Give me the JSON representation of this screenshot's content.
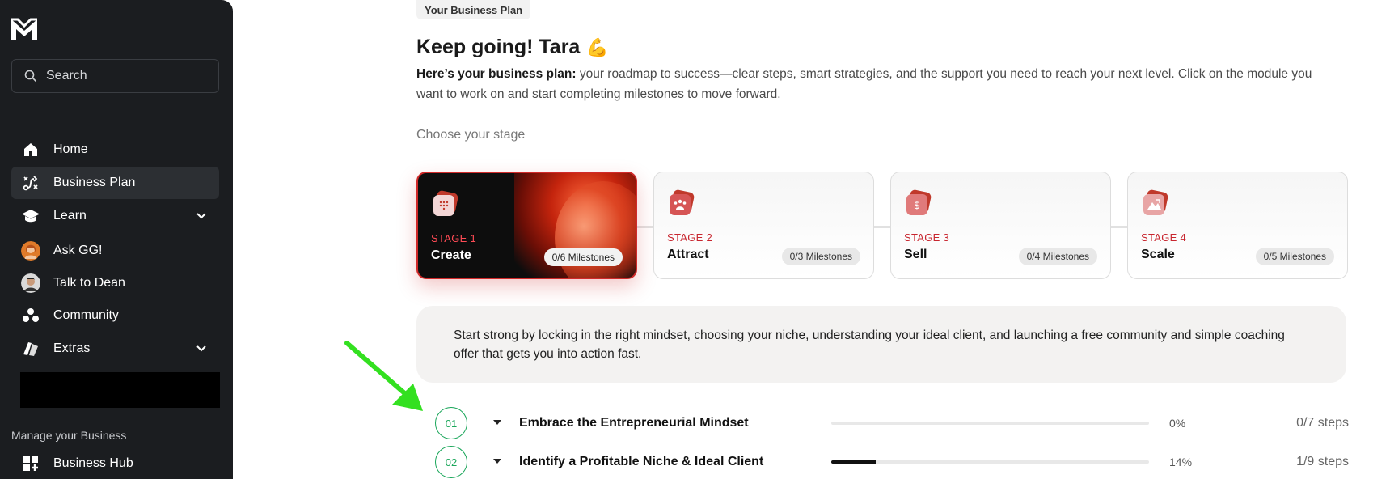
{
  "sidebar": {
    "search_placeholder": "Search",
    "items": [
      {
        "label": "Home",
        "icon": "home-icon"
      },
      {
        "label": "Business Plan",
        "icon": "route-icon"
      },
      {
        "label": "Learn",
        "icon": "graduation-cap-icon"
      },
      {
        "label": "Ask GG!",
        "icon": "avatar"
      },
      {
        "label": "Talk to Dean",
        "icon": "avatar"
      },
      {
        "label": "Community",
        "icon": "community-icon"
      },
      {
        "label": "Extras",
        "icon": "extras-icon"
      }
    ],
    "section_label": "Manage your Business",
    "hub_label": "Business Hub"
  },
  "header": {
    "tag": "Your Business Plan",
    "greeting": "Keep going! Tara",
    "emoji": "💪",
    "intro_bold": "Here’s your business plan:",
    "intro_rest": " your roadmap to success—clear steps, smart strategies, and the support you need to reach your next level. Click on the module you want to work on and start completing milestones to move forward.",
    "choose_label": "Choose your stage"
  },
  "stages": [
    {
      "label": "STAGE 1",
      "name": "Create",
      "milestones": "0/6 Milestones"
    },
    {
      "label": "STAGE 2",
      "name": "Attract",
      "milestones": "0/3 Milestones"
    },
    {
      "label": "STAGE 3",
      "name": "Sell",
      "milestones": "0/4 Milestones"
    },
    {
      "label": "STAGE 4",
      "name": "Scale",
      "milestones": "0/5 Milestones"
    }
  ],
  "description": "Start strong by locking in the right mindset, choosing your niche, understanding your ideal client, and launching a free community and simple coaching offer that gets you into action fast.",
  "modules": [
    {
      "num": "01",
      "title": "Embrace the Entrepreneurial Mindset",
      "progress": 0,
      "pct": "0%",
      "steps": "0/7 steps"
    },
    {
      "num": "02",
      "title": "Identify a Profitable Niche & Ideal Client",
      "progress": 0.14,
      "pct": "14%",
      "steps": "1/9 steps"
    }
  ],
  "colors": {
    "accent": "#d12a2a",
    "success": "#1aa65a",
    "sidebar": "#1b1d20"
  }
}
